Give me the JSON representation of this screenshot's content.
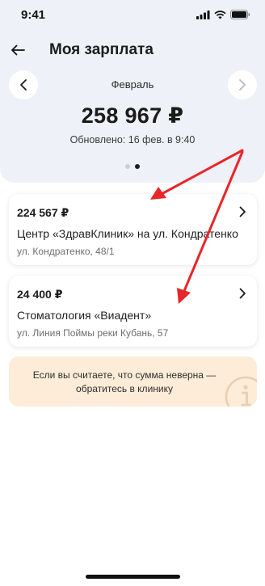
{
  "status_bar": {
    "time": "9:41",
    "icons": [
      "signal-icon",
      "wifi-icon",
      "battery-icon"
    ]
  },
  "header": {
    "title": "Моя зарплата",
    "back_icon": "arrow-left-icon"
  },
  "period": {
    "month": "Февраль",
    "total": "258 967 ₽",
    "updated": "Обновлено: 16 фев. в 9:40",
    "pager_pages": 2,
    "pager_active": 2
  },
  "clinics": [
    {
      "amount": "224 567 ₽",
      "name": "Центр «ЗдравКлиник» на ул. Кондратенко",
      "address": "ул. Кондратенко, 48/1"
    },
    {
      "amount": "24 400 ₽",
      "name": "Стоматология «Виадент»",
      "address": "ул. Линия Поймы реки Кубань, 57"
    }
  ],
  "notice": {
    "text": "Если вы считаете, что сумма неверна — обратитесь в клинику",
    "icon": "info-icon"
  },
  "colors": {
    "header_bg": "#eef1f7",
    "notice_bg": "#fdecd8",
    "annotation_arrow": "#e8262a"
  }
}
